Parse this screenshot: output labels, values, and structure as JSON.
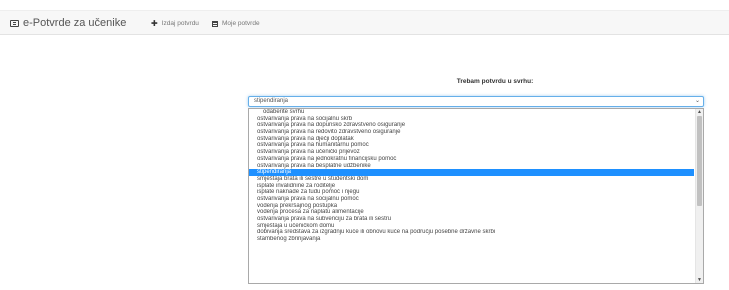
{
  "navbar": {
    "brand": "e-Potvrde za učenike",
    "items": [
      {
        "label": "Izdaj potvrdu",
        "icon": "plus-icon"
      },
      {
        "label": "Moje potvrde",
        "icon": "document-icon"
      }
    ]
  },
  "form": {
    "heading": "Trebam potvrdu u svrhu:",
    "selected_value": "stipendiranja"
  },
  "dropdown": {
    "options": [
      "odaberite svrhu",
      "ostvarivanja prava na socijalnu skrb",
      "ostvarivanja prava na dopunsko zdravstveno osiguranje",
      "ostvarivanja prava na redovito zdravstveno osiguranje",
      "ostvarivanja prava na dječji doplatak",
      "ostvarivanja prava na humanitarnu pomoć",
      "ostvarivanja prava na učenički prijevoz",
      "ostvarivanja prava na jednokratnu financijsku pomoć",
      "ostvarivanja prava na besplatne udžbenike",
      "stipendiranja",
      "smještaja brata ili sestre u studentski dom",
      "isplate invalidnine za roditelje",
      "isplate naknade za tuđu pomoć i njegu",
      "ostvarivanja prava na socijalnu pomoć",
      "vođenja prekršajnog postupka",
      "vođenja procesa za naplatu alimentacije",
      "ostvarivanja prava na subvenciju za brata ili sestru",
      "smještaja u učeničkom domu",
      "dobivanja sredstava za izgradnju kuće ili obnovu kuće na području posebne državne skrbi",
      "stambenog zbrinjavanja"
    ],
    "selected_index": 9
  },
  "colors": {
    "selected_bg": "#1e90ff",
    "focus_border": "#66afe9",
    "navbar_bg": "#f7f7f7"
  }
}
